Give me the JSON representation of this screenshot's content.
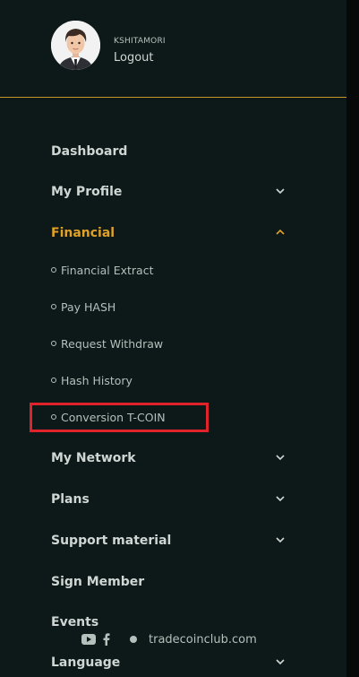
{
  "user": {
    "name": "KSHITAMORI",
    "logout_label": "Logout"
  },
  "menu": {
    "dashboard": "Dashboard",
    "my_profile": "My Profile",
    "financial": "Financial",
    "financial_sub": {
      "extract": "Financial Extract",
      "pay_hash": "Pay HASH",
      "withdraw": "Request Withdraw",
      "hash_history": "Hash History",
      "conversion": "Conversion T-COIN"
    },
    "my_network": "My Network",
    "plans": "Plans",
    "support": "Support material",
    "sign_member": "Sign Member",
    "events": "Events",
    "language": "Language"
  },
  "footer": {
    "site": "tradecoinclub.com",
    "icons": [
      "youtube-icon",
      "facebook-icon",
      "dot-icon"
    ]
  },
  "colors": {
    "accent": "#e0a126",
    "highlight": "#e0222b",
    "background": "#0c1918"
  }
}
